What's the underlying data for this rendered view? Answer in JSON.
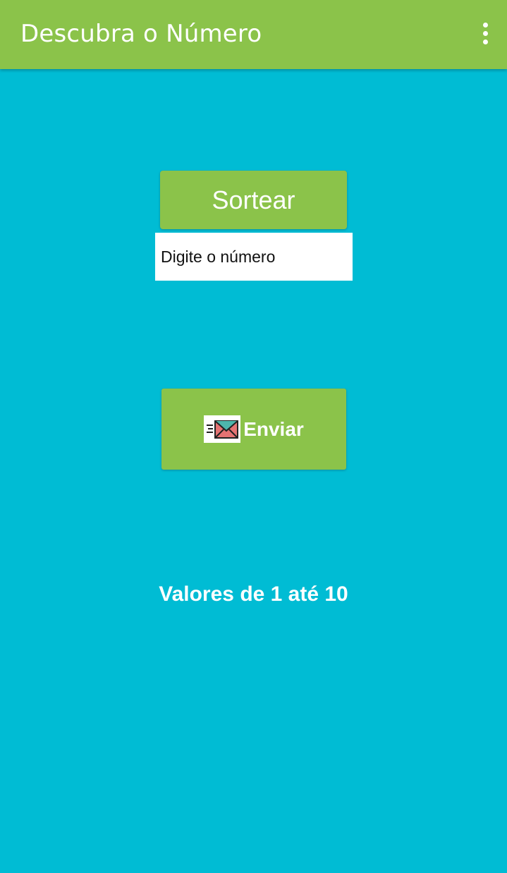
{
  "app_bar": {
    "title": "Descubra o Número",
    "menu_icon": "more-vert-icon"
  },
  "main": {
    "sortear_label": "Sortear",
    "input_placeholder": "Digite o número",
    "input_value": "",
    "enviar_label": "Enviar",
    "enviar_icon": "send-mail-icon",
    "range_text": "Valores de 1 até 10"
  },
  "colors": {
    "app_bar": "#8BC34A",
    "background": "#00BCD4",
    "button": "#8BC34A",
    "text": "#FFFFFF"
  }
}
